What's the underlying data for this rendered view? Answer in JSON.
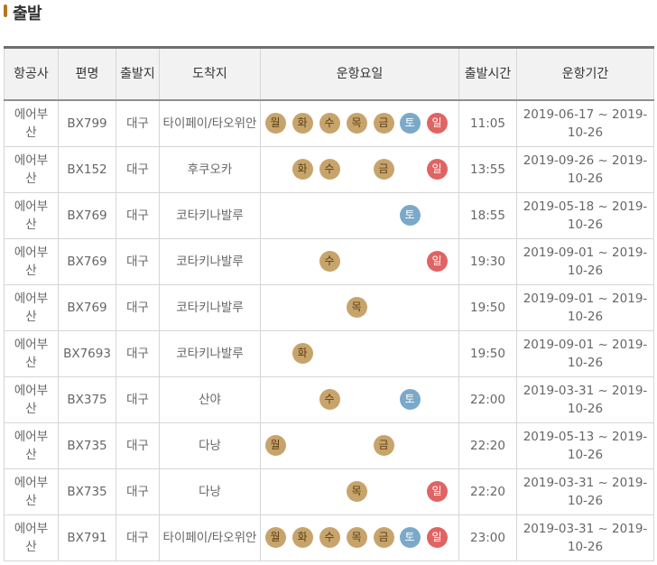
{
  "section": {
    "title": "출발"
  },
  "table": {
    "headers": [
      "항공사",
      "편명",
      "출발지",
      "도착지",
      "운항요일",
      "출발시간",
      "운항기간"
    ],
    "day_labels": [
      "월",
      "화",
      "수",
      "목",
      "금",
      "토",
      "일"
    ],
    "rows": [
      {
        "airline": "에어부산",
        "flight": "BX799",
        "from": "대구",
        "to": "타이페이/타오위안",
        "days": [
          1,
          1,
          1,
          1,
          1,
          1,
          1
        ],
        "time": "11:05",
        "period": "2019-06-17 ~ 2019-10-26"
      },
      {
        "airline": "에어부산",
        "flight": "BX152",
        "from": "대구",
        "to": "후쿠오카",
        "days": [
          0,
          1,
          1,
          0,
          1,
          0,
          1
        ],
        "time": "13:55",
        "period": "2019-09-26 ~ 2019-10-26"
      },
      {
        "airline": "에어부산",
        "flight": "BX769",
        "from": "대구",
        "to": "코타키나발루",
        "days": [
          0,
          0,
          0,
          0,
          0,
          1,
          0
        ],
        "time": "18:55",
        "period": "2019-05-18 ~ 2019-10-26"
      },
      {
        "airline": "에어부산",
        "flight": "BX769",
        "from": "대구",
        "to": "코타키나발루",
        "days": [
          0,
          0,
          1,
          0,
          0,
          0,
          1
        ],
        "time": "19:30",
        "period": "2019-09-01 ~ 2019-10-26"
      },
      {
        "airline": "에어부산",
        "flight": "BX769",
        "from": "대구",
        "to": "코타키나발루",
        "days": [
          0,
          0,
          0,
          1,
          0,
          0,
          0
        ],
        "time": "19:50",
        "period": "2019-09-01 ~ 2019-10-26"
      },
      {
        "airline": "에어부산",
        "flight": "BX7693",
        "from": "대구",
        "to": "코타키나발루",
        "days": [
          0,
          1,
          0,
          0,
          0,
          0,
          0
        ],
        "time": "19:50",
        "period": "2019-09-01 ~ 2019-10-26"
      },
      {
        "airline": "에어부산",
        "flight": "BX375",
        "from": "대구",
        "to": "산야",
        "days": [
          0,
          0,
          1,
          0,
          0,
          1,
          0
        ],
        "time": "22:00",
        "period": "2019-03-31 ~ 2019-10-26"
      },
      {
        "airline": "에어부산",
        "flight": "BX735",
        "from": "대구",
        "to": "다낭",
        "days": [
          1,
          0,
          0,
          0,
          1,
          0,
          0
        ],
        "time": "22:20",
        "period": "2019-05-13 ~ 2019-10-26"
      },
      {
        "airline": "에어부산",
        "flight": "BX735",
        "from": "대구",
        "to": "다낭",
        "days": [
          0,
          0,
          0,
          1,
          0,
          0,
          1
        ],
        "time": "22:20",
        "period": "2019-03-31 ~ 2019-10-26"
      },
      {
        "airline": "에어부산",
        "flight": "BX791",
        "from": "대구",
        "to": "타이페이/타오위안",
        "days": [
          1,
          1,
          1,
          1,
          1,
          1,
          1
        ],
        "time": "23:00",
        "period": "2019-03-31 ~ 2019-10-26"
      }
    ]
  },
  "colors": {
    "weekday": "#c7a46c",
    "saturday": "#7aa9c9",
    "sunday": "#e06464",
    "accent": "#b5761f"
  }
}
